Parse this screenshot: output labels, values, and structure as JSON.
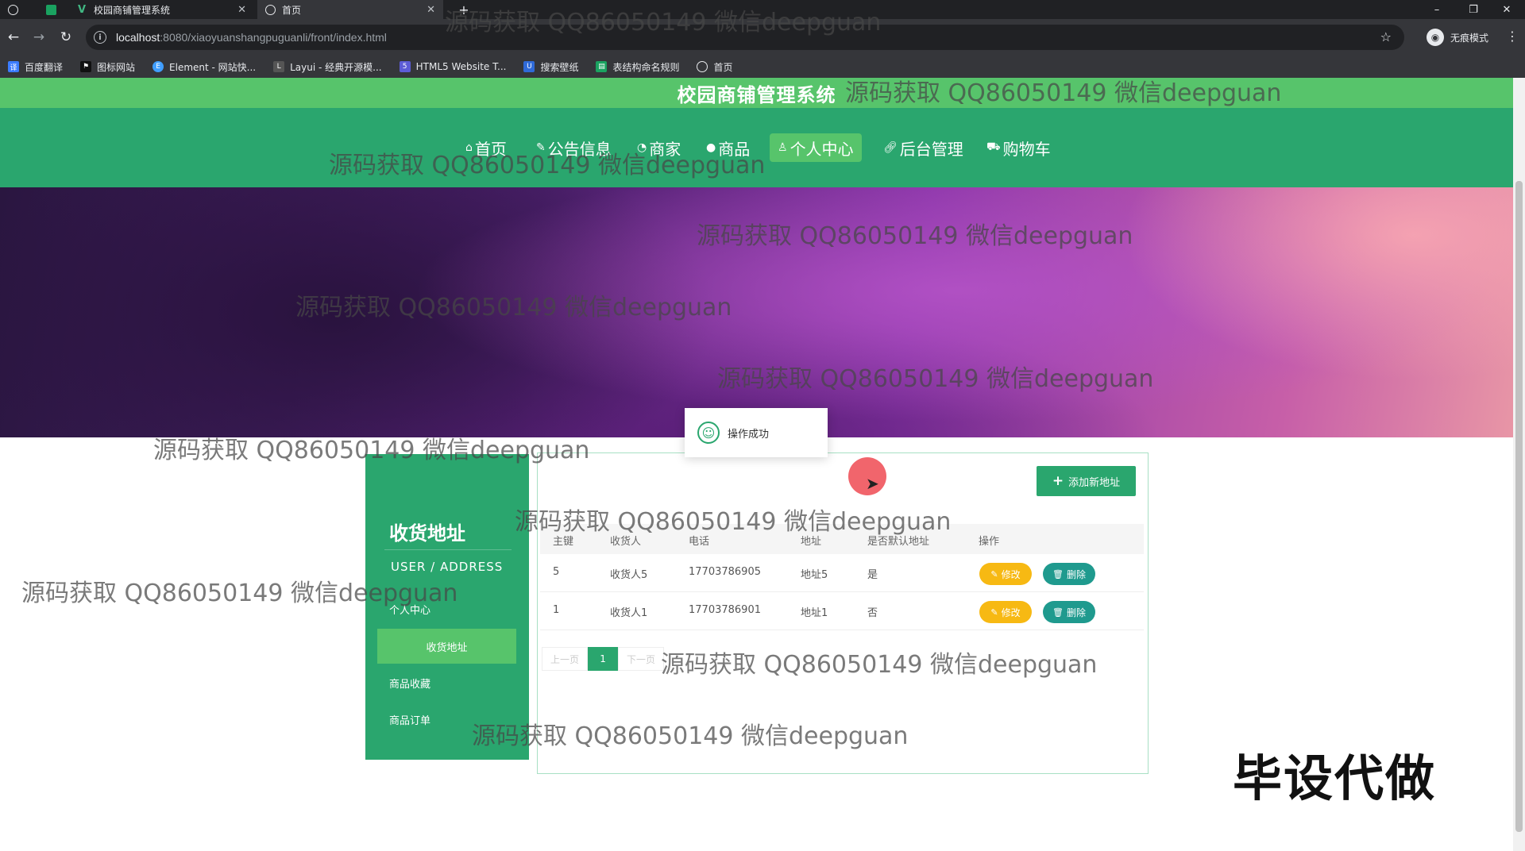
{
  "browser": {
    "tabs": [
      {
        "label": "校园商铺管理系统"
      },
      {
        "label": "首页"
      }
    ],
    "new_tab": "+",
    "url_host": "localhost",
    "url_rest": ":8080/xiaoyuanshangpuguanli/front/index.html",
    "incognito_label": "无痕模式",
    "bookmarks": [
      {
        "label": "百度翻译",
        "color": "#3b7cff"
      },
      {
        "label": "图标网站",
        "color": "#111111"
      },
      {
        "label": "Element - 网站快...",
        "color": "#409eff"
      },
      {
        "label": "Layui - 经典开源模...",
        "color": "#555555"
      },
      {
        "label": "HTML5 Website T...",
        "color": "#5c5cd6"
      },
      {
        "label": "搜索壁纸",
        "color": "#2f6ad8"
      },
      {
        "label": "表结构命名规则",
        "color": "#1aa260"
      },
      {
        "label": "首页",
        "color": "#e8eaed"
      }
    ]
  },
  "site": {
    "title": "校园商铺管理系统",
    "nav": [
      {
        "label": "首页",
        "icon": "home-icon"
      },
      {
        "label": "公告信息",
        "icon": "notice-icon"
      },
      {
        "label": "商家",
        "icon": "shop-icon"
      },
      {
        "label": "商品",
        "icon": "goods-icon"
      },
      {
        "label": "个人中心",
        "icon": "user-icon"
      },
      {
        "label": "后台管理",
        "icon": "link-icon"
      },
      {
        "label": "购物车",
        "icon": "cart-icon"
      }
    ],
    "accent": "#2aa66e",
    "accent_light": "#57c46b"
  },
  "sidebar": {
    "title": "收货地址",
    "subtitle": "USER / ADDRESS",
    "items": [
      {
        "label": "个人中心"
      },
      {
        "label": "收货地址"
      },
      {
        "label": "商品收藏"
      },
      {
        "label": "商品订单"
      }
    ]
  },
  "content": {
    "add_button": "添加新地址",
    "columns": [
      "主键",
      "收货人",
      "电话",
      "地址",
      "是否默认地址",
      "操作"
    ],
    "rows": [
      {
        "id": "5",
        "name": "收货人5",
        "phone": "17703786905",
        "address": "地址5",
        "default": "是"
      },
      {
        "id": "1",
        "name": "收货人1",
        "phone": "17703786901",
        "address": "地址1",
        "default": "否"
      }
    ],
    "edit_label": "修改",
    "delete_label": "删除",
    "pager": {
      "prev": "上一页",
      "current": "1",
      "next": "下一页"
    }
  },
  "toast": {
    "message": "操作成功"
  },
  "overlay": {
    "watermark": "源码获取 QQ86050149 微信deepguan",
    "stamp": "毕设代做"
  }
}
